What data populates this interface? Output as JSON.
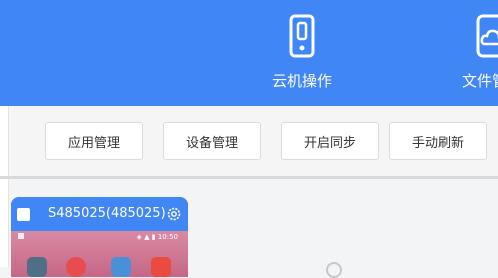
{
  "header": {
    "nav": [
      {
        "label": "云机操作",
        "icon": "phone-icon"
      },
      {
        "label": "文件管理",
        "icon": "cloud-folder-icon"
      }
    ],
    "background": "#4186f5"
  },
  "toolbar": {
    "app_manage": "应用管理",
    "device_manage": "设备管理",
    "enable_sync": "开启同步",
    "manual_refresh": "手动刷新"
  },
  "devices": [
    {
      "name": "S485025(485025)",
      "settings_icon": "gear-icon",
      "status_time": "10:50",
      "status_indicators": "◈ ▲ ▮"
    }
  ]
}
